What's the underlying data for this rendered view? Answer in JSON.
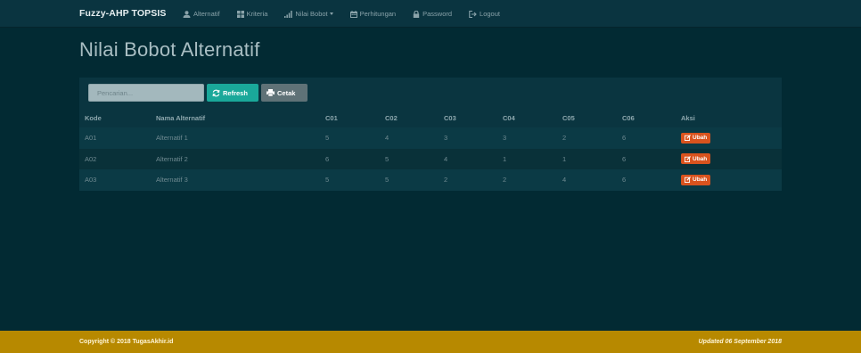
{
  "navbar": {
    "brand": "Fuzzy-AHP TOPSIS",
    "items": [
      {
        "label": "Alternatif",
        "icon": "user-icon"
      },
      {
        "label": "Kriteria",
        "icon": "grid-icon"
      },
      {
        "label": "Nilai Bobot",
        "icon": "signal-icon",
        "dropdown": true
      },
      {
        "label": "Perhitungan",
        "icon": "calendar-icon"
      },
      {
        "label": "Password",
        "icon": "lock-icon"
      },
      {
        "label": "Logout",
        "icon": "logout-icon"
      }
    ]
  },
  "page": {
    "title": "Nilai Bobot Alternatif"
  },
  "toolbar": {
    "search_placeholder": "Pencarian...",
    "refresh_label": "Refresh",
    "print_label": "Cetak"
  },
  "table": {
    "headers": [
      "Kode",
      "Nama Alternatif",
      "C01",
      "C02",
      "C03",
      "C04",
      "C05",
      "C06",
      "Aksi"
    ],
    "rows": [
      {
        "kode": "A01",
        "nama": "Alternatif 1",
        "c01": "5",
        "c02": "4",
        "c03": "3",
        "c04": "3",
        "c05": "2",
        "c06": "6",
        "aksi": "Ubah"
      },
      {
        "kode": "A02",
        "nama": "Alternatif 2",
        "c01": "6",
        "c02": "5",
        "c03": "4",
        "c04": "1",
        "c05": "1",
        "c06": "6",
        "aksi": "Ubah"
      },
      {
        "kode": "A03",
        "nama": "Alternatif 3",
        "c01": "5",
        "c02": "5",
        "c03": "2",
        "c04": "2",
        "c05": "4",
        "c06": "6",
        "aksi": "Ubah"
      }
    ]
  },
  "footer": {
    "copyright": "Copyright © 2018 TugasAkhir.id",
    "updated": "Updated 06 September 2018"
  },
  "colors": {
    "background": "#022a33",
    "navbar": "#0a3440",
    "panel": "#0a3540",
    "refresh": "#1aa89a",
    "print": "#5f7277",
    "ubah": "#d9531e",
    "footer": "#b78900"
  }
}
